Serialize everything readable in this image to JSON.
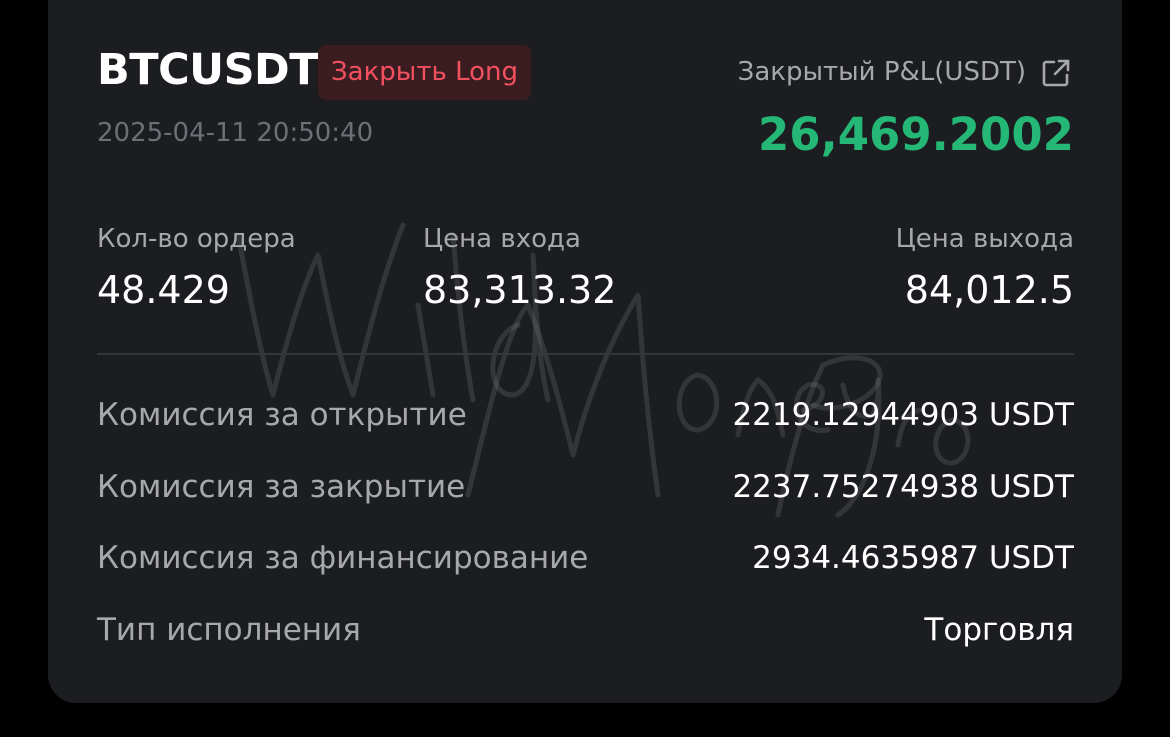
{
  "trade": {
    "symbol": "BTCUSDT",
    "side_badge": "Закрыть Long",
    "datetime": "2025-04-11 20:50:40",
    "pnl_label": "Закрытый P&L(USDT)",
    "pnl_value": "26,469.2002",
    "share_icon": "external-link-icon"
  },
  "stats": [
    {
      "label": "Кол-во ордера",
      "value": "48.429"
    },
    {
      "label": "Цена входа",
      "value": "83,313.32"
    },
    {
      "label": "Цена выхода",
      "value": "84,012.5"
    }
  ],
  "details": [
    {
      "label": "Комиссия за открытие",
      "value": "2219.12944903 USDT"
    },
    {
      "label": "Комиссия за закрытие",
      "value": "2237.75274938 USDT"
    },
    {
      "label": "Комиссия за финансирование",
      "value": "2934.4635987 USDT"
    },
    {
      "label": "Тип исполнения",
      "value": "Торговля"
    }
  ],
  "watermark": {
    "text": "Wild Money Pro"
  },
  "colors": {
    "background": "#000000",
    "card": "#1c1d21",
    "profit_green": "#25b775",
    "close_red": "#f1505f",
    "badge_bg": "#3b1d21",
    "label_gray": "#a6a8ad",
    "muted_gray": "#6c6f76"
  }
}
